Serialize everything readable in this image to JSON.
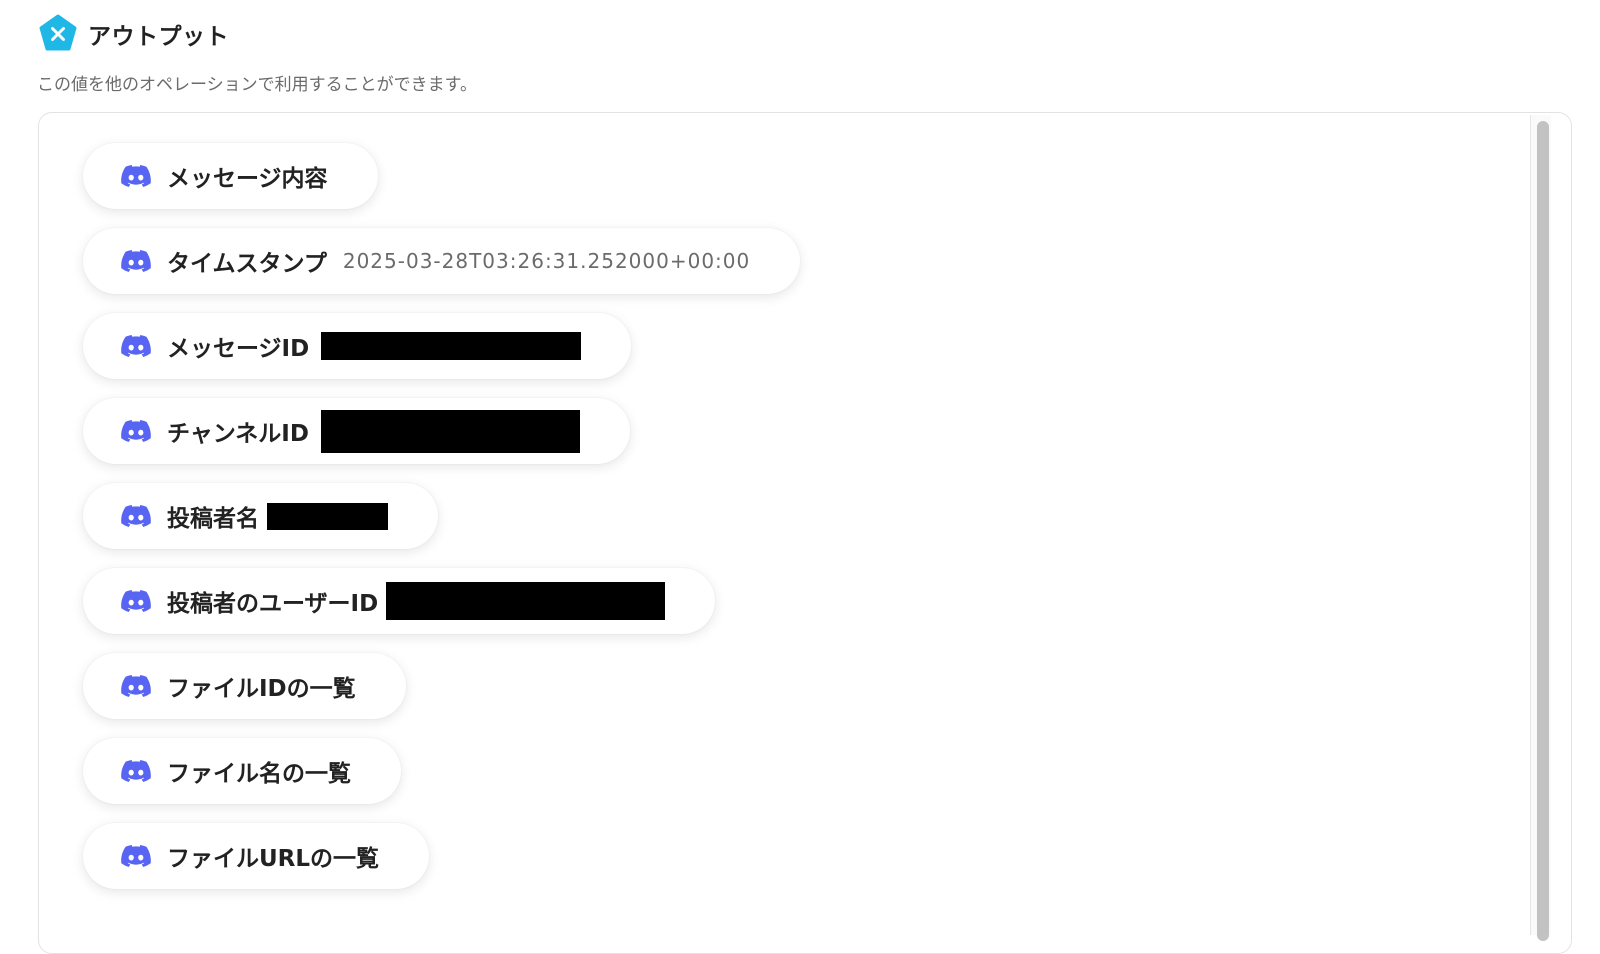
{
  "header": {
    "title": "アウトプット",
    "subtitle": "この値を他のオペレーションで利用することができます。",
    "logo_icon": "yoom-x-icon",
    "logo_color": "#1fb8e6"
  },
  "item_icon": "discord-icon",
  "icon_color": "#5865F2",
  "items": [
    {
      "label": "メッセージ内容",
      "value": ""
    },
    {
      "label": "タイムスタンプ",
      "value": "2025-03-28T03:26:31.252000+00:00"
    },
    {
      "label": "メッセージID",
      "value": "",
      "redacted": true
    },
    {
      "label": "チャンネルID",
      "value": "",
      "redacted": true
    },
    {
      "label": "投稿者名",
      "value": "",
      "redacted": true
    },
    {
      "label": "投稿者のユーザーID",
      "value": "",
      "redacted": true
    },
    {
      "label": "ファイルIDの一覧",
      "value": ""
    },
    {
      "label": "ファイル名の一覧",
      "value": ""
    },
    {
      "label": "ファイルURLの一覧",
      "value": ""
    }
  ]
}
